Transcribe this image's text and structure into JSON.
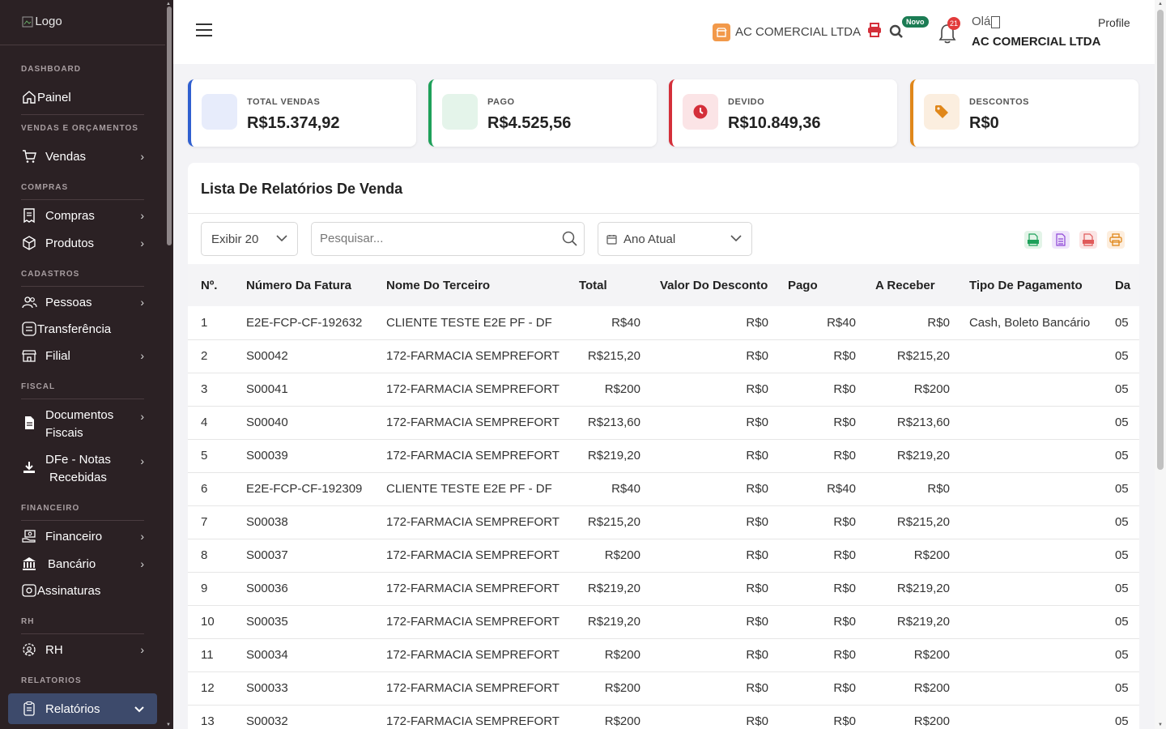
{
  "sidebar": {
    "logo_alt": "Logo",
    "sections": {
      "dashboard": "DASHBOARD",
      "vendas": "VENDAS E ORÇAMENTOS",
      "compras": "COMPRAS",
      "cadastros": "CADASTROS",
      "fiscal": "FISCAL",
      "financeiro": "FINANCEIRO",
      "rh": "RH",
      "relatorios": "RELATORIOS"
    },
    "items": {
      "painel": "Painel",
      "vendas": "Vendas",
      "compras": "Compras",
      "produtos": "Produtos",
      "pessoas": "Pessoas",
      "transferencia": "Transferência",
      "filial": "Filial",
      "documentos_l1": "Documentos",
      "documentos_l2": "Fiscais",
      "dfe_l1": "DFe - Notas",
      "dfe_l2": "Recebidas",
      "financeiro": "Financeiro",
      "bancario": "Bancário",
      "assinaturas": "Assinaturas",
      "rh": "RH",
      "relatorios": "Relatórios"
    }
  },
  "header": {
    "company": "AC COMERCIAL LTDA",
    "novo_badge": "Novo",
    "notification_count": "21",
    "greeting": "Olá",
    "user_name": "AC COMERCIAL LTDA",
    "profile_alt": "Profile"
  },
  "cards": [
    {
      "label": "TOTAL VENDAS",
      "value": "R$15.374,92",
      "accent": "#2f5fd0"
    },
    {
      "label": "PAGO",
      "value": "R$4.525,56",
      "accent": "#1ea05a"
    },
    {
      "label": "DEVIDO",
      "value": "R$10.849,36",
      "accent": "#d42f3a"
    },
    {
      "label": "DESCONTOS",
      "value": "R$0",
      "accent": "#e0871a"
    }
  ],
  "panel": {
    "title": "Lista De Relatórios De Venda",
    "show_select": "Exibir 20",
    "search_placeholder": "Pesquisar...",
    "period_select": "Ano Atual"
  },
  "table": {
    "headers": [
      "Nº.",
      "Número Da Fatura",
      "Nome Do Terceiro",
      "Total",
      "Valor Do Desconto",
      "Pago",
      "A Receber",
      "Tipo De Pagamento",
      "Da"
    ],
    "rows": [
      [
        "1",
        "E2E-FCP-CF-192632",
        "CLIENTE TESTE E2E PF - DF",
        "R$40",
        "R$0",
        "R$40",
        "R$0",
        "Cash, Boleto Bancário",
        "05"
      ],
      [
        "2",
        "S00042",
        "172-FARMACIA SEMPREFORT",
        "R$215,20",
        "R$0",
        "R$0",
        "R$215,20",
        "",
        "05"
      ],
      [
        "3",
        "S00041",
        "172-FARMACIA SEMPREFORT",
        "R$200",
        "R$0",
        "R$0",
        "R$200",
        "",
        "05"
      ],
      [
        "4",
        "S00040",
        "172-FARMACIA SEMPREFORT",
        "R$213,60",
        "R$0",
        "R$0",
        "R$213,60",
        "",
        "05"
      ],
      [
        "5",
        "S00039",
        "172-FARMACIA SEMPREFORT",
        "R$219,20",
        "R$0",
        "R$0",
        "R$219,20",
        "",
        "05"
      ],
      [
        "6",
        "E2E-FCP-CF-192309",
        "CLIENTE TESTE E2E PF - DF",
        "R$40",
        "R$0",
        "R$40",
        "R$0",
        "",
        "05"
      ],
      [
        "7",
        "S00038",
        "172-FARMACIA SEMPREFORT",
        "R$215,20",
        "R$0",
        "R$0",
        "R$215,20",
        "",
        "05"
      ],
      [
        "8",
        "S00037",
        "172-FARMACIA SEMPREFORT",
        "R$200",
        "R$0",
        "R$0",
        "R$200",
        "",
        "05"
      ],
      [
        "9",
        "S00036",
        "172-FARMACIA SEMPREFORT",
        "R$219,20",
        "R$0",
        "R$0",
        "R$219,20",
        "",
        "05"
      ],
      [
        "10",
        "S00035",
        "172-FARMACIA SEMPREFORT",
        "R$219,20",
        "R$0",
        "R$0",
        "R$219,20",
        "",
        "05"
      ],
      [
        "11",
        "S00034",
        "172-FARMACIA SEMPREFORT",
        "R$200",
        "R$0",
        "R$0",
        "R$200",
        "",
        "05"
      ],
      [
        "12",
        "S00033",
        "172-FARMACIA SEMPREFORT",
        "R$200",
        "R$0",
        "R$0",
        "R$200",
        "",
        "05"
      ],
      [
        "13",
        "S00032",
        "172-FARMACIA SEMPREFORT",
        "R$200",
        "R$0",
        "R$0",
        "R$200",
        "",
        "05"
      ]
    ]
  }
}
